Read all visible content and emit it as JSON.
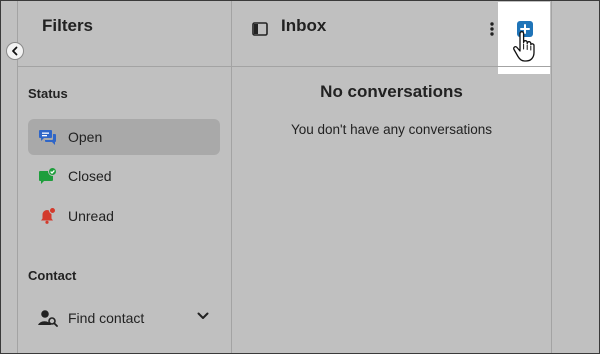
{
  "filters": {
    "title": "Filters",
    "status_label": "Status",
    "status_items": [
      {
        "label": "Open",
        "icon": "chat-bubbles-icon",
        "active": true
      },
      {
        "label": "Closed",
        "icon": "chat-check-icon",
        "active": false
      },
      {
        "label": "Unread",
        "icon": "bell-badge-icon",
        "active": false
      }
    ],
    "contact_label": "Contact",
    "contact_item": {
      "label": "Find contact",
      "icon": "person-search-icon"
    }
  },
  "inbox": {
    "title": "Inbox",
    "empty_title": "No conversations",
    "empty_message": "You don't have any conversations"
  },
  "colors": {
    "accent": "#1f74b8",
    "open_icon": "#2f66c8",
    "closed_icon": "#1e9e3c",
    "unread_icon": "#d33a2c",
    "background": "#c0c0c0",
    "active_row": "#a9a9a9"
  }
}
